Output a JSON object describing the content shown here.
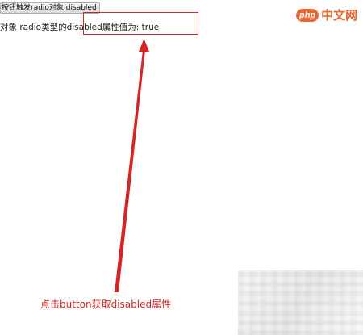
{
  "demo": {
    "button_label": "按钮触发radio对象 disabled",
    "result_text": "对象 radio类型的disabled属性值为: true",
    "annotation_caption": "点击button获取disabled属性"
  },
  "watermark": {
    "php": "php",
    "site_name": "中文网"
  },
  "colors": {
    "annotation": "#d42626",
    "watermark": "#e9672f"
  }
}
